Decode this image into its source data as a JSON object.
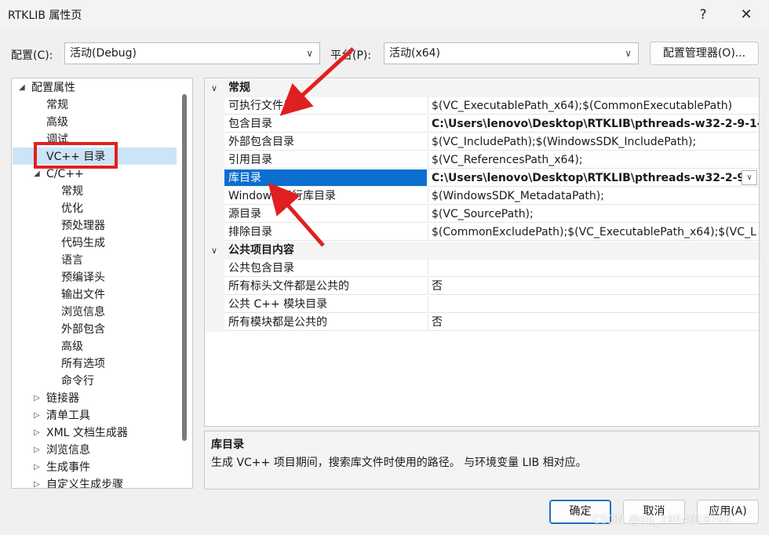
{
  "window": {
    "title": "RTKLIB 属性页",
    "help_glyph": "?",
    "close_glyph": "✕"
  },
  "config": {
    "label": "配置(C):",
    "value": "活动(Debug)"
  },
  "platform": {
    "label": "平台(P):",
    "value": "活动(x64)"
  },
  "config_manager_label": "配置管理器(O)...",
  "tree": {
    "items": [
      {
        "label": "配置属性",
        "expander": "◢"
      },
      {
        "label": "常规"
      },
      {
        "label": "高级"
      },
      {
        "label": "调试"
      },
      {
        "label": "VC++ 目录",
        "selected": true
      },
      {
        "label": "C/C++",
        "expander": "◢"
      },
      {
        "label": "常规"
      },
      {
        "label": "优化"
      },
      {
        "label": "预处理器"
      },
      {
        "label": "代码生成"
      },
      {
        "label": "语言"
      },
      {
        "label": "预编译头"
      },
      {
        "label": "输出文件"
      },
      {
        "label": "浏览信息"
      },
      {
        "label": "外部包含"
      },
      {
        "label": "高级"
      },
      {
        "label": "所有选项"
      },
      {
        "label": "命令行"
      },
      {
        "label": "链接器",
        "expander": "▷"
      },
      {
        "label": "清单工具",
        "expander": "▷"
      },
      {
        "label": "XML 文档生成器",
        "expander": "▷"
      },
      {
        "label": "浏览信息",
        "expander": "▷"
      },
      {
        "label": "生成事件",
        "expander": "▷"
      },
      {
        "label": "自定义生成步骤",
        "expander": "▷"
      }
    ]
  },
  "grid": {
    "categories": [
      {
        "name": "常规",
        "rows": [
          {
            "name": "可执行文件目录",
            "value": "$(VC_ExecutablePath_x64);$(CommonExecutablePath)"
          },
          {
            "name": "包含目录",
            "value": "C:\\Users\\lenovo\\Desktop\\RTKLIB\\pthreads-w32-2-9-1-r",
            "bold": true
          },
          {
            "name": "外部包含目录",
            "value": "$(VC_IncludePath);$(WindowsSDK_IncludePath);"
          },
          {
            "name": "引用目录",
            "value": "$(VC_ReferencesPath_x64);"
          },
          {
            "name": "库目录",
            "value": "C:\\Users\\lenovo\\Desktop\\RTKLIB\\pthreads-w32-2-9-",
            "bold": true,
            "selected": true
          },
          {
            "name": "Windows 运行库目录",
            "value": "$(WindowsSDK_MetadataPath);"
          },
          {
            "name": "源目录",
            "value": "$(VC_SourcePath);"
          },
          {
            "name": "排除目录",
            "value": "$(CommonExcludePath);$(VC_ExecutablePath_x64);$(VC_L"
          }
        ]
      },
      {
        "name": "公共项目内容",
        "rows": [
          {
            "name": "公共包含目录",
            "value": ""
          },
          {
            "name": "所有标头文件都是公共的",
            "value": "否"
          },
          {
            "name": "公共 C++ 模块目录",
            "value": ""
          },
          {
            "name": "所有模块都是公共的",
            "value": "否"
          }
        ]
      }
    ]
  },
  "description": {
    "title": "库目录",
    "text": "生成 VC++ 项目期间，搜索库文件时使用的路径。 与环境变量 LIB 相对应。"
  },
  "buttons": {
    "ok": "确定",
    "cancel": "取消",
    "apply": "应用(A)"
  },
  "watermark": "CSDN @qq_1964618701",
  "colors": {
    "selection": "#0a6fcf",
    "annotation": "#e02020",
    "tree_selection": "#cce4f7"
  }
}
